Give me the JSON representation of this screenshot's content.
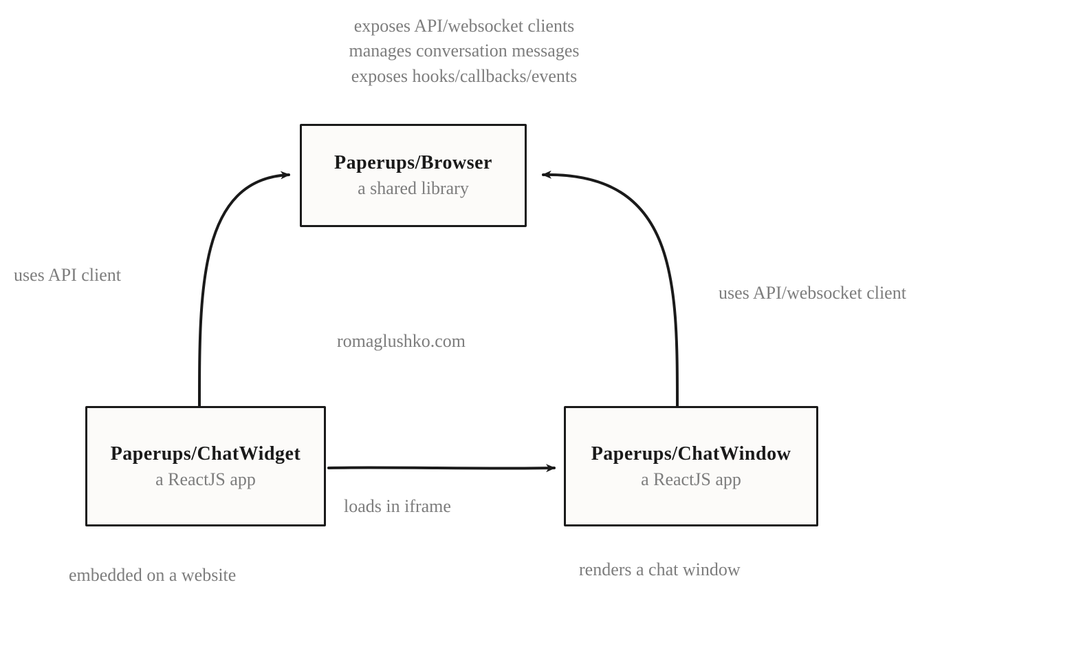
{
  "boxes": {
    "browser": {
      "title": "Paperups/Browser",
      "subtitle": "a shared library"
    },
    "chatwidget": {
      "title": "Paperups/ChatWidget",
      "subtitle": "a ReactJS app"
    },
    "chatwindow": {
      "title": "Paperups/ChatWindow",
      "subtitle": "a ReactJS app"
    }
  },
  "annotations": {
    "top": {
      "line1": "exposes API/websocket clients",
      "line2": "manages conversation messages",
      "line3": "exposes hooks/callbacks/events"
    },
    "left_edge": "uses API client",
    "right_edge": "uses API/websocket client",
    "center_watermark": "romaglushko.com",
    "middle_edge": "loads in iframe",
    "bottom_left": "embedded on a website",
    "bottom_right": "renders a chat window"
  },
  "edges": {
    "widget_to_browser": {
      "from": "chatwidget",
      "to": "browser",
      "label_key": "left_edge"
    },
    "window_to_browser": {
      "from": "chatwindow",
      "to": "browser",
      "label_key": "right_edge"
    },
    "widget_to_window": {
      "from": "chatwidget",
      "to": "chatwindow",
      "label_key": "middle_edge"
    }
  },
  "colors": {
    "box_border": "#1a1a1a",
    "box_bg": "#fcfbf9",
    "text_title": "#1a1a1a",
    "text_muted": "#7d7d7d",
    "arrow": "#1a1a1a"
  }
}
